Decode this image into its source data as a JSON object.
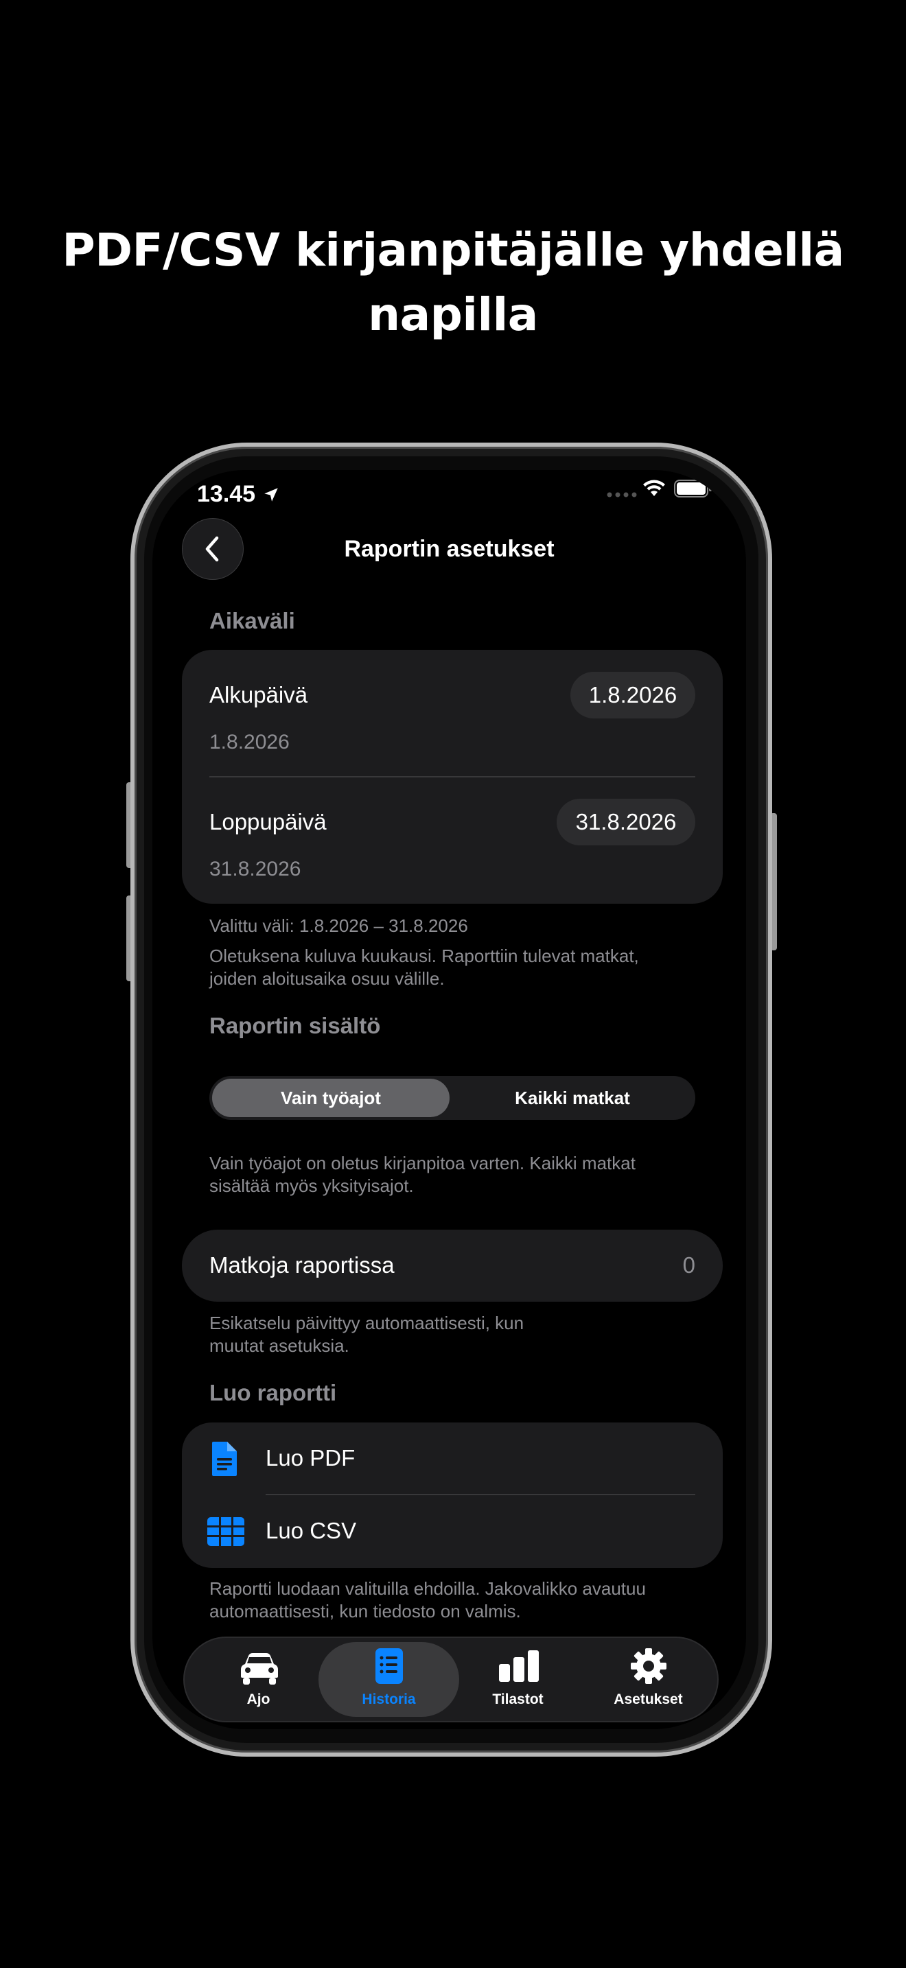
{
  "headline": {
    "line1": "PDF/CSV kirjanpitäjälle yhdellä",
    "line2": "napilla"
  },
  "status_bar": {
    "time": "13.45",
    "icons": [
      "location-arrow-icon",
      "signal-dots-icon",
      "wifi-icon",
      "battery-icon"
    ]
  },
  "nav": {
    "title": "Raportin asetukset",
    "back_icon": "chevron-left-icon"
  },
  "date_range": {
    "section_title": "Aikaväli",
    "start": {
      "label": "Alkupäivä",
      "value": "1.8.2026",
      "sub": "1.8.2026"
    },
    "end": {
      "label": "Loppupäivä",
      "value": "31.8.2026",
      "sub": "31.8.2026"
    },
    "selected_text": "Valittu väli: 1.8.2026 – 31.8.2026",
    "hint_line1": "Oletuksena kuluva kuukausi. Raporttiin tulevat matkat,",
    "hint_line2": "joiden aloitusaika osuu välille."
  },
  "content": {
    "section_title": "Raportin sisältö",
    "segments": [
      "Vain työajot",
      "Kaikki matkat"
    ],
    "selected_segment": "Vain työajot",
    "hint_line1": "Vain työajot on oletus kirjanpitoa varten. Kaikki matkat",
    "hint_line2": "sisältää myös yksityisajot."
  },
  "trip_count": {
    "label": "Matkoja raportissa",
    "value": "0",
    "hint_line1": "Esikatselu päivittyy automaattisesti, kun",
    "hint_line2": "muutat asetuksia."
  },
  "create": {
    "section_title": "Luo raportti",
    "pdf_label": "Luo PDF",
    "csv_label": "Luo CSV",
    "hint_line1": "Raportti luodaan valituilla ehdoilla. Jakovalikko avautuu",
    "hint_line2": "automaattisesti, kun tiedosto on valmis."
  },
  "tabbar": {
    "tabs": [
      {
        "label": "Ajo",
        "icon": "car-icon"
      },
      {
        "label": "Historia",
        "icon": "document-list-icon"
      },
      {
        "label": "Tilastot",
        "icon": "bar-chart-icon"
      },
      {
        "label": "Asetukset",
        "icon": "gear-icon"
      }
    ],
    "active": "Historia"
  },
  "colors": {
    "accent": "#0a84ff",
    "background": "#000000",
    "card": "#1c1c1e",
    "secondary_text": "#8e8e93"
  }
}
